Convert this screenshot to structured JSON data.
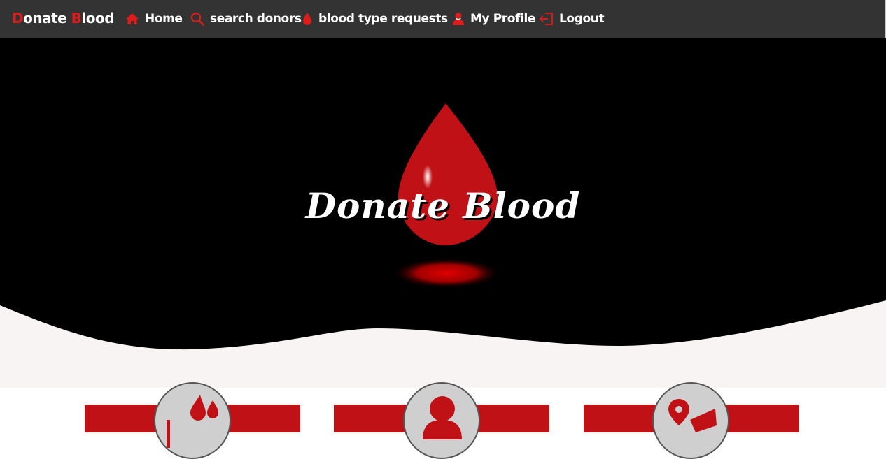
{
  "nav": {
    "brand_first_letter": "D",
    "brand_first_rest": "onate ",
    "brand_second_letter": "B",
    "brand_second_rest": "lood",
    "items": [
      {
        "label": "Home",
        "icon": "home-icon"
      },
      {
        "label": "search donors",
        "icon": "search-icon"
      },
      {
        "label": "blood type requests",
        "icon": "blood-drop-icon",
        "has_dropdown": true
      },
      {
        "label": "My Profile",
        "icon": "user-icon"
      },
      {
        "label": "Logout",
        "icon": "logout-icon"
      }
    ]
  },
  "hero": {
    "title": "Donate Blood"
  },
  "features": {
    "cards": [
      {
        "icon": "blood-drops-icon"
      },
      {
        "icon": "user-icon"
      },
      {
        "icon": "map-pin-icon"
      }
    ]
  },
  "colors": {
    "accent": "#c01216",
    "navbar": "#333333",
    "hero": "#000000",
    "section_bg": "#f9f4f4"
  }
}
